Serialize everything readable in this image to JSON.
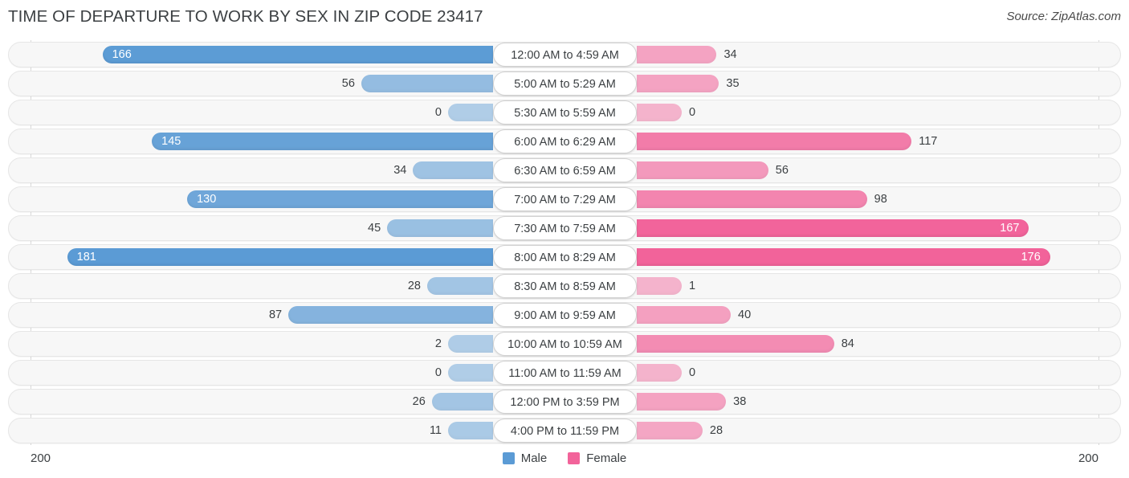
{
  "header": {
    "title": "TIME OF DEPARTURE TO WORK BY SEX IN ZIP CODE 23417",
    "source": "Source: ZipAtlas.com"
  },
  "footer": {
    "axis_max_left": "200",
    "axis_max_right": "200"
  },
  "legend": {
    "items": [
      {
        "label": "Male",
        "color": "#5b9bd5"
      },
      {
        "label": "Female",
        "color": "#f2639a"
      }
    ]
  },
  "chart_data": {
    "type": "bar",
    "subtype": "diverging-bidirectional",
    "title": "TIME OF DEPARTURE TO WORK BY SEX IN ZIP CODE 23417",
    "xlabel": "",
    "ylabel": "",
    "xlim": [
      0,
      200
    ],
    "grid": false,
    "legend_position": "bottom-center",
    "axis_max_left": 200,
    "axis_max_right": 200,
    "categories": [
      "12:00 AM to 4:59 AM",
      "5:00 AM to 5:29 AM",
      "5:30 AM to 5:59 AM",
      "6:00 AM to 6:29 AM",
      "6:30 AM to 6:59 AM",
      "7:00 AM to 7:29 AM",
      "7:30 AM to 7:59 AM",
      "8:00 AM to 8:29 AM",
      "8:30 AM to 8:59 AM",
      "9:00 AM to 9:59 AM",
      "10:00 AM to 10:59 AM",
      "11:00 AM to 11:59 AM",
      "12:00 PM to 3:59 PM",
      "4:00 PM to 11:59 PM"
    ],
    "series": [
      {
        "name": "Male",
        "color": "#5b9bd5",
        "direction": "left",
        "values": [
          166,
          56,
          0,
          145,
          34,
          130,
          45,
          181,
          28,
          87,
          2,
          0,
          26,
          11
        ]
      },
      {
        "name": "Female",
        "color": "#f2639a",
        "direction": "right",
        "values": [
          34,
          35,
          0,
          117,
          56,
          98,
          167,
          176,
          1,
          40,
          84,
          0,
          38,
          28
        ]
      }
    ]
  }
}
